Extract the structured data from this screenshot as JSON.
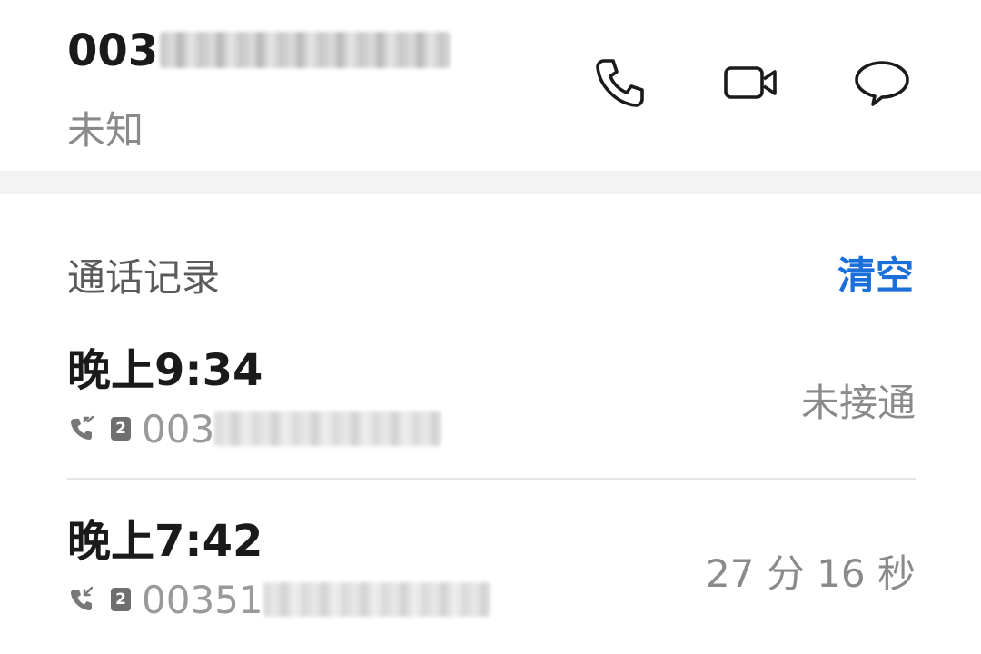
{
  "header": {
    "number_visible": "003",
    "location": "未知",
    "actions": [
      {
        "icon": "phone-icon"
      },
      {
        "icon": "video-icon"
      },
      {
        "icon": "message-icon"
      }
    ]
  },
  "call_log": {
    "title": "通话记录",
    "clear_label": "清空",
    "accent_color": "#1a6fd9",
    "items": [
      {
        "time": "晚上9:34",
        "call_type_icon": "missed-call-icon",
        "sim": "2",
        "number_visible": "003",
        "status": "未接通"
      },
      {
        "time": "晚上7:42",
        "call_type_icon": "incoming-call-icon",
        "sim": "2",
        "number_visible": "00351",
        "status": "27 分 16 秒"
      }
    ]
  }
}
